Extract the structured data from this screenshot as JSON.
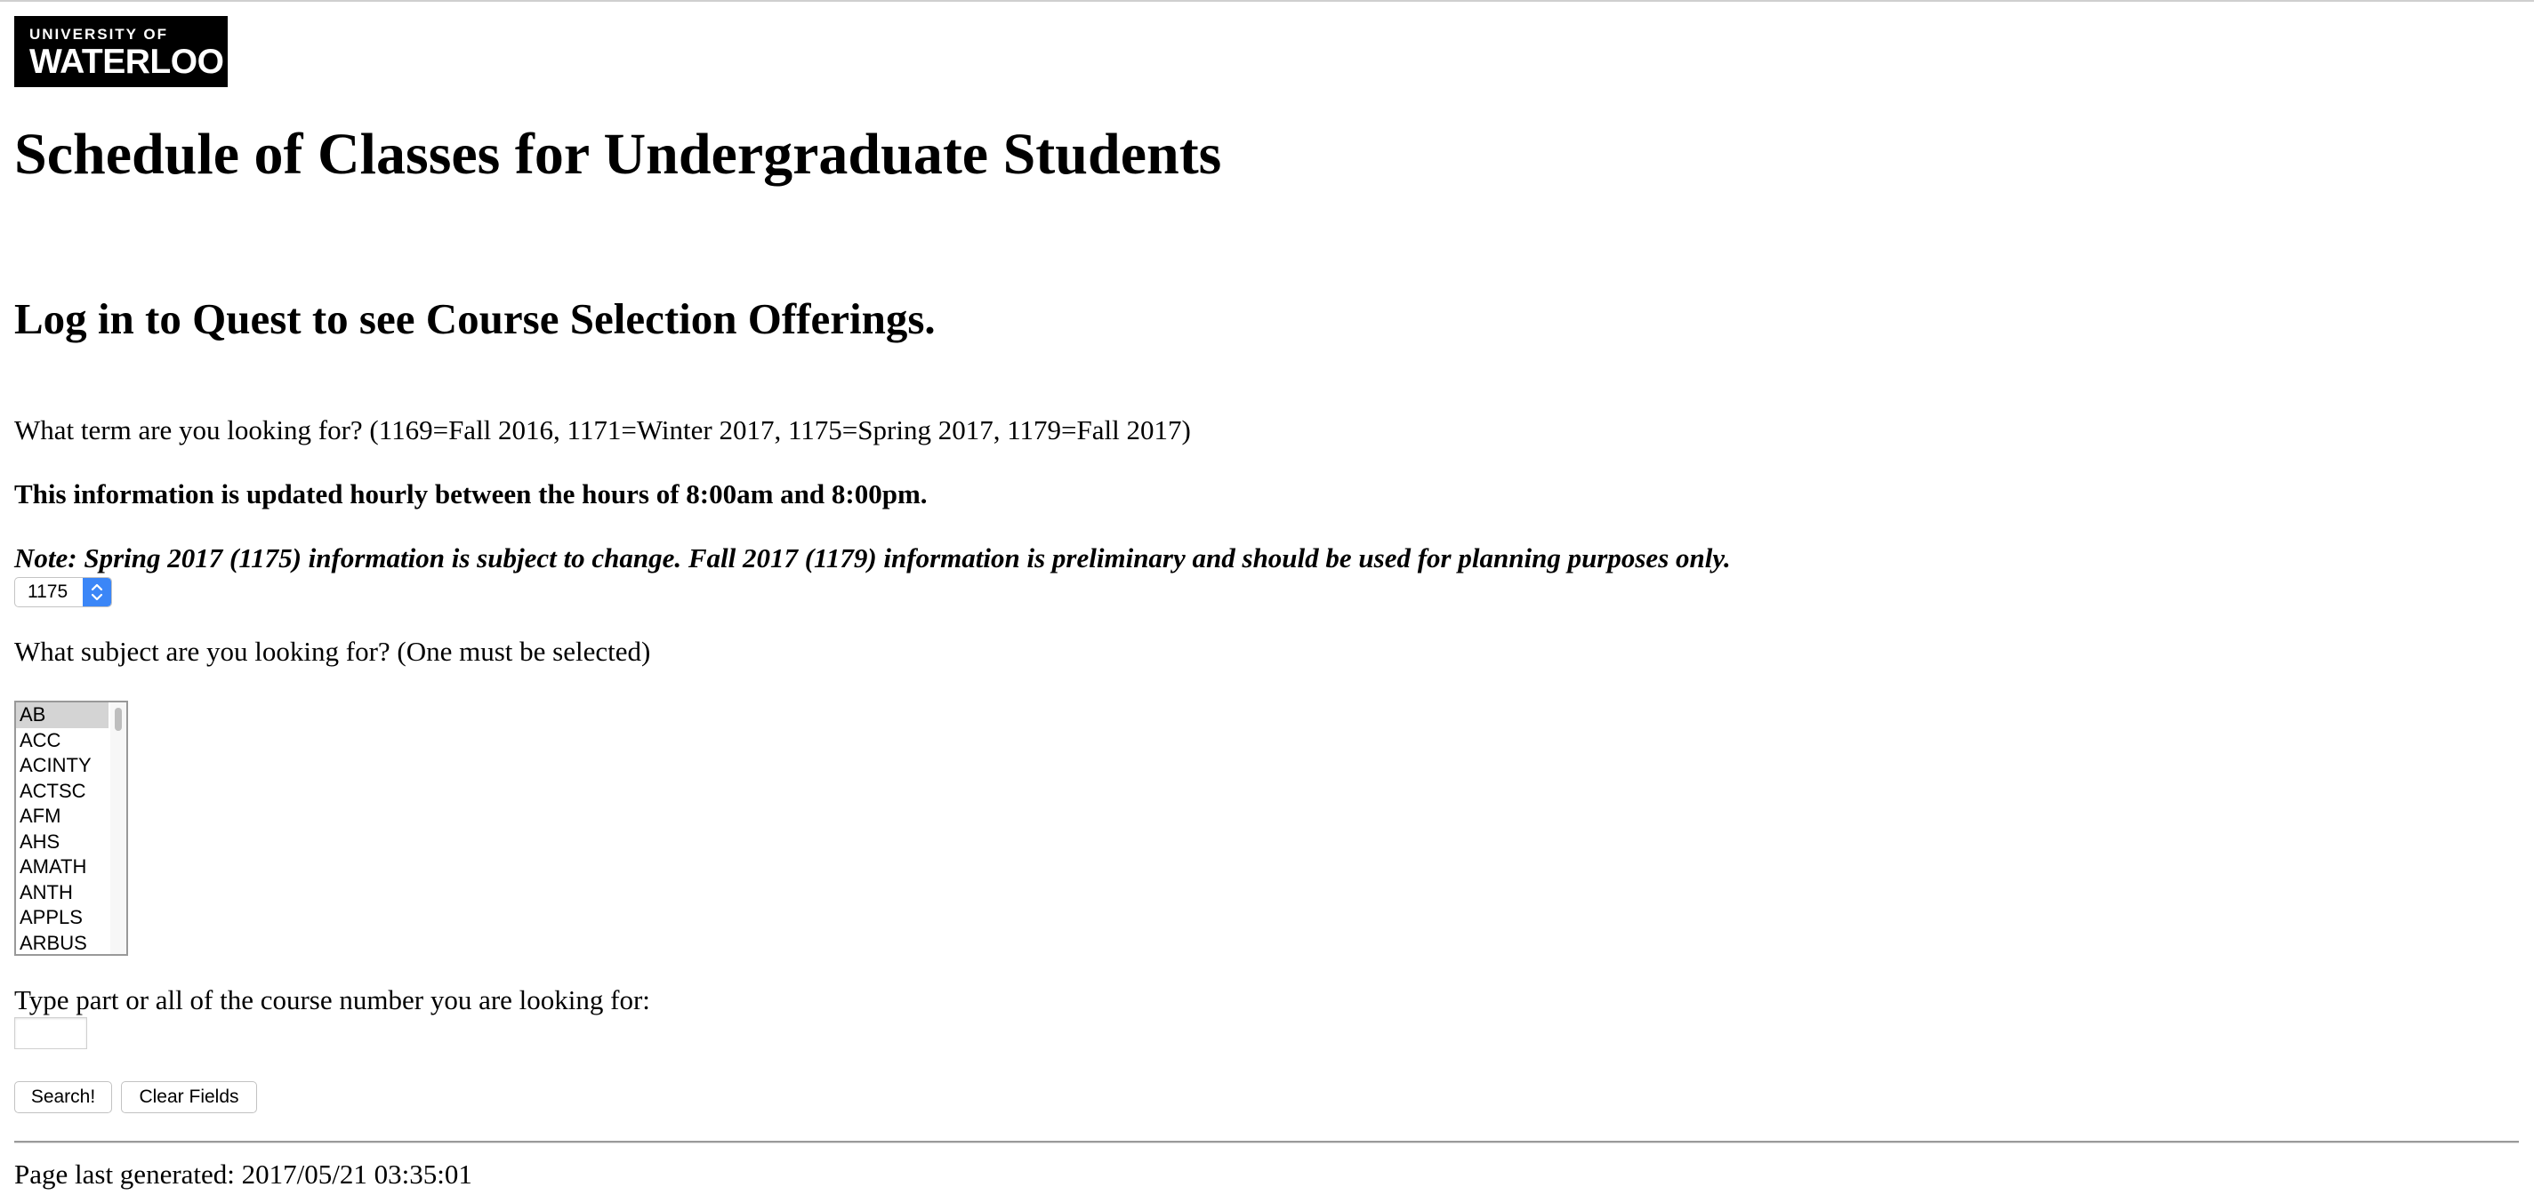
{
  "logo": {
    "line1": "UNIVERSITY OF",
    "line2": "WATERLOO"
  },
  "page_title": "Schedule of Classes for Undergraduate Students",
  "login_heading": "Log in to Quest to see Course Selection Offerings.",
  "term": {
    "question": "What term are you looking for? (1169=Fall 2016, 1171=Winter 2017, 1175=Spring 2017, 1179=Fall 2017)",
    "update_note": "This information is updated hourly between the hours of 8:00am and 8:00pm.",
    "prelim_note": "Note: Spring 2017 (1175) information is subject to change. Fall 2017 (1179) information is preliminary and should be used for planning purposes only.",
    "selected": "1175",
    "arrows_icon": "up-down-chevron-icon",
    "accent_color": "#3b86f7"
  },
  "subject": {
    "question": "What subject are you looking for? (One must be selected)",
    "options": [
      "AB",
      "ACC",
      "ACINTY",
      "ACTSC",
      "AFM",
      "AHS",
      "AMATH",
      "ANTH",
      "APPLS",
      "ARBUS"
    ],
    "selected": "AB"
  },
  "course": {
    "question": "Type part or all of the course number you are looking for:",
    "value": ""
  },
  "buttons": {
    "search": "Search!",
    "clear": "Clear Fields"
  },
  "footer": {
    "generated": "Page last generated: 2017/05/21 03:35:01"
  }
}
